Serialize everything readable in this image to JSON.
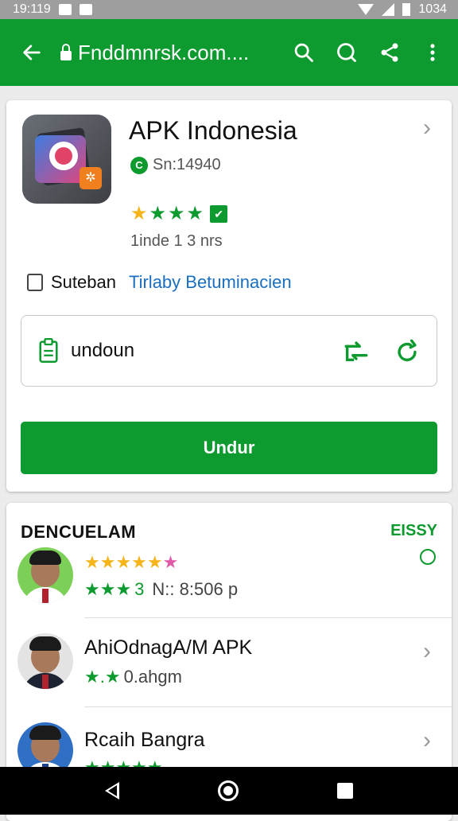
{
  "status_bar": {
    "time": "19:119",
    "right_text": "1034"
  },
  "browser": {
    "url": "Fnddmnrsk.com...."
  },
  "app": {
    "title": "APK Indonesia",
    "package_id": "Sn:14940",
    "rating_value": 4,
    "installs": "1inde 1 3 nrs",
    "checkbox_label": "Suteban",
    "link_text": "Tirlaby Betuminacien",
    "download_field": "undoun",
    "primary_button": "Undur"
  },
  "section": {
    "title": "DENCUELAM",
    "link": "EISSY"
  },
  "list": [
    {
      "name": "",
      "sub": "N:: 8:506 p",
      "sub_prefix": "3",
      "stars": "★★★★★",
      "extra_star": "★"
    },
    {
      "name": "AhiOdnagA/M APK",
      "sub": "0.ahgm",
      "sub_prefix": "★.★"
    },
    {
      "name": "Rcaih Bangra",
      "sub": ""
    }
  ],
  "colors": {
    "primary_green": "#0d9a2e",
    "star_yellow": "#f4b41a",
    "link_blue": "#1a6fc0"
  }
}
